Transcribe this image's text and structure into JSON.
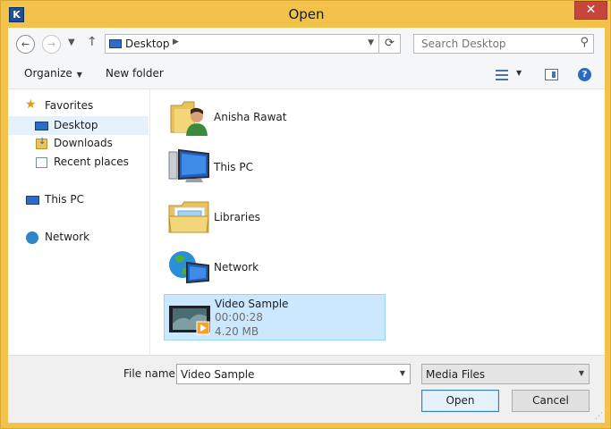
{
  "window": {
    "title": "Open",
    "app_icon_letter": "K"
  },
  "address": {
    "location": "Desktop",
    "search_placeholder": "Search Desktop"
  },
  "toolbar": {
    "organize_label": "Organize",
    "new_folder_label": "New folder"
  },
  "navpane": {
    "items": [
      {
        "label": "Favorites",
        "icon": "star-icon"
      },
      {
        "label": "Desktop",
        "icon": "desktop-icon",
        "selected": true
      },
      {
        "label": "Downloads",
        "icon": "downloads-icon"
      },
      {
        "label": "Recent places",
        "icon": "recent-places-icon"
      },
      {
        "label": "This PC",
        "icon": "this-pc-icon"
      },
      {
        "label": "Network",
        "icon": "network-icon"
      }
    ]
  },
  "files": [
    {
      "name": "Anisha Rawat",
      "icon": "user-folder-icon"
    },
    {
      "name": "This PC",
      "icon": "computer-icon"
    },
    {
      "name": "Libraries",
      "icon": "libraries-icon"
    },
    {
      "name": "Network",
      "icon": "network-globe-icon"
    },
    {
      "name": "Video Sample",
      "icon": "video-thumbnail-icon",
      "duration": "00:00:28",
      "size": "4.20 MB",
      "selected": true
    }
  ],
  "bottom": {
    "file_name_label": "File name:",
    "file_name_value": "Video Sample",
    "file_type": "Media Files",
    "open_label": "Open",
    "cancel_label": "Cancel"
  },
  "colors": {
    "frame": "#f3c24a",
    "close": "#c7463b",
    "selection": "#cce8ff",
    "selection_border": "#99d1ff"
  }
}
